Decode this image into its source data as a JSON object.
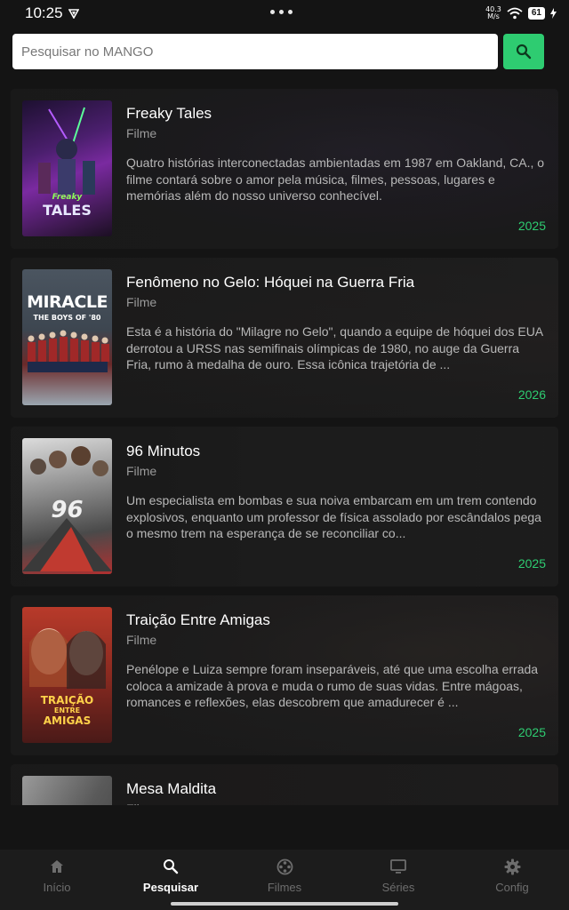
{
  "status_bar": {
    "time": "10:25",
    "net_speed_value": "40.3",
    "net_speed_unit": "M/s",
    "battery": "61"
  },
  "search": {
    "placeholder": "Pesquisar no MANGO",
    "value": ""
  },
  "results": [
    {
      "title": "Freaky Tales",
      "type": "Filme",
      "description": "Quatro histórias interconectadas ambientadas em 1987 em Oakland, CA., o filme contará sobre o amor pela música, filmes, pessoas, lugares e memórias além do nosso universo conhecível.",
      "year": "2025",
      "poster_text": "Freaky TALES"
    },
    {
      "title": "Fenômeno no Gelo: Hóquei na Guerra Fria",
      "type": "Filme",
      "description": "Esta é a história do \"Milagre no Gelo\", quando a equipe de hóquei dos EUA derrotou a URSS nas semifinais olímpicas de 1980, no auge da Guerra Fria, rumo à medalha de ouro. Essa icônica trajetória de ...",
      "year": "2026",
      "poster_text": "MIRACLE",
      "poster_subtext": "THE BOYS OF '80"
    },
    {
      "title": "96 Minutos",
      "type": "Filme",
      "description": "Um especialista em bombas e sua noiva embarcam em um trem contendo explosivos, enquanto um professor de física assolado por escândalos pega o mesmo trem na esperança de se reconciliar co...",
      "year": "2025",
      "poster_text": "96"
    },
    {
      "title": "Traição Entre Amigas",
      "type": "Filme",
      "description": "Penélope e Luiza sempre foram inseparáveis, até que uma escolha errada coloca a amizade à prova e muda o rumo de suas vidas. Entre mágoas, romances e reflexões, elas descobrem que amadurecer é ...",
      "year": "2025",
      "poster_text": "TRAIÇÃO ENTRE AMIGAS"
    },
    {
      "title": "Mesa Maldita",
      "type": "Filme",
      "description": "",
      "year": ""
    }
  ],
  "nav": {
    "items": [
      {
        "label": "Início",
        "icon": "home-icon",
        "active": false
      },
      {
        "label": "Pesquisar",
        "icon": "search-icon",
        "active": true
      },
      {
        "label": "Filmes",
        "icon": "film-reel-icon",
        "active": false
      },
      {
        "label": "Séries",
        "icon": "tv-icon",
        "active": false
      },
      {
        "label": "Config",
        "icon": "gear-icon",
        "active": false
      }
    ]
  },
  "colors": {
    "accent": "#2ecc71",
    "background": "#141414",
    "nav_background": "#1c1c1c"
  }
}
